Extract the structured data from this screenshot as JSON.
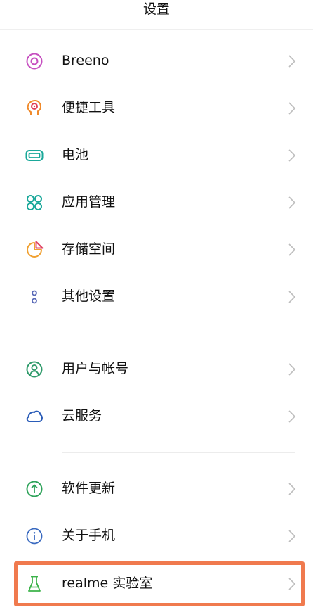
{
  "header": {
    "title": "设置"
  },
  "settings": {
    "items": [
      {
        "label": "Breeno",
        "icon": "breeno-icon"
      },
      {
        "label": "便捷工具",
        "icon": "convenience-tools-icon"
      },
      {
        "label": "电池",
        "icon": "battery-icon"
      },
      {
        "label": "应用管理",
        "icon": "app-management-icon"
      },
      {
        "label": "存储空间",
        "icon": "storage-icon"
      },
      {
        "label": "其他设置",
        "icon": "other-settings-icon"
      },
      {
        "label": "用户与帐号",
        "icon": "users-accounts-icon"
      },
      {
        "label": "云服务",
        "icon": "cloud-icon"
      },
      {
        "label": "软件更新",
        "icon": "software-update-icon"
      },
      {
        "label": "关于手机",
        "icon": "about-phone-icon"
      },
      {
        "label": "realme 实验室",
        "icon": "lab-flask-icon",
        "highlighted": true
      }
    ]
  },
  "colors": {
    "highlight_border": "#f07a4e",
    "breeno": "#c64fc0",
    "convenience": "#f08a2b",
    "battery": "#1aa89a",
    "apps": "#1aa89a",
    "storage": "#f0a030",
    "other": "#5a6ab8",
    "users": "#2e9a6a",
    "cloud": "#2a5cb8",
    "update": "#2ea35a",
    "about": "#3a6ac0",
    "lab": "#3cb34a"
  }
}
